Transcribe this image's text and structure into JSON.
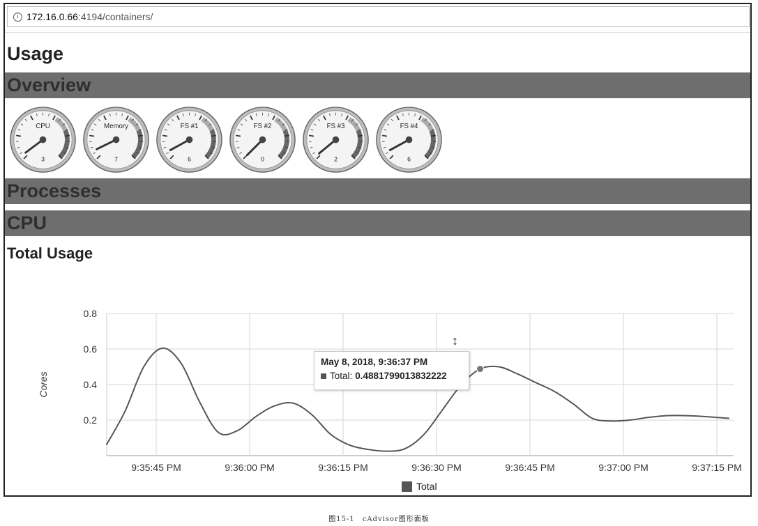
{
  "browser": {
    "url_host": "172.16.0.66",
    "url_port_path": ":4194/containers/"
  },
  "page": {
    "title": "Usage",
    "sections": {
      "overview": "Overview",
      "processes": "Processes",
      "cpu": "CPU"
    },
    "total_usage_title": "Total Usage"
  },
  "gauges": [
    {
      "label": "CPU",
      "value": "3",
      "level": 0.03
    },
    {
      "label": "Memory",
      "value": "7",
      "level": 0.07
    },
    {
      "label": "FS #1",
      "value": "6",
      "level": 0.06
    },
    {
      "label": "FS #2",
      "value": "0",
      "level": 0.0
    },
    {
      "label": "FS #3",
      "value": "2",
      "level": 0.02
    },
    {
      "label": "FS #4",
      "value": "6",
      "level": 0.06
    }
  ],
  "chart_data": {
    "type": "line",
    "title": "",
    "ylabel": "Cores",
    "xlabel": "",
    "ylim": [
      0,
      0.8
    ],
    "y_ticks": [
      "0.2",
      "0.4",
      "0.6",
      "0.8"
    ],
    "x_ticks": [
      "9:35:45 PM",
      "9:36:00 PM",
      "9:36:15 PM",
      "9:36:30 PM",
      "9:36:45 PM",
      "9:37:00 PM",
      "9:37:15 PM"
    ],
    "grid": true,
    "legend_position": "bottom",
    "series": [
      {
        "name": "Total",
        "color": "#555555",
        "points": [
          [
            "9:35:37 PM",
            0.06
          ],
          [
            "9:35:40 PM",
            0.25
          ],
          [
            "9:35:43 PM",
            0.5
          ],
          [
            "9:35:46 PM",
            0.605
          ],
          [
            "9:35:49 PM",
            0.52
          ],
          [
            "9:35:52 PM",
            0.3
          ],
          [
            "9:35:55 PM",
            0.13
          ],
          [
            "9:35:58 PM",
            0.14
          ],
          [
            "9:36:01 PM",
            0.22
          ],
          [
            "9:36:04 PM",
            0.28
          ],
          [
            "9:36:07 PM",
            0.295
          ],
          [
            "9:36:10 PM",
            0.23
          ],
          [
            "9:36:13 PM",
            0.12
          ],
          [
            "9:36:16 PM",
            0.06
          ],
          [
            "9:36:19 PM",
            0.035
          ],
          [
            "9:36:22 PM",
            0.025
          ],
          [
            "9:36:25 PM",
            0.04
          ],
          [
            "9:36:28 PM",
            0.12
          ],
          [
            "9:36:31 PM",
            0.26
          ],
          [
            "9:36:34 PM",
            0.4
          ],
          [
            "9:36:37 PM",
            0.4881799013832222
          ],
          [
            "9:36:40 PM",
            0.5
          ],
          [
            "9:36:43 PM",
            0.46
          ],
          [
            "9:36:46 PM",
            0.41
          ],
          [
            "9:36:49 PM",
            0.36
          ],
          [
            "9:36:52 PM",
            0.29
          ],
          [
            "9:36:55 PM",
            0.21
          ],
          [
            "9:36:58 PM",
            0.195
          ],
          [
            "9:37:01 PM",
            0.2
          ],
          [
            "9:37:04 PM",
            0.215
          ],
          [
            "9:37:07 PM",
            0.225
          ],
          [
            "9:37:10 PM",
            0.225
          ],
          [
            "9:37:13 PM",
            0.22
          ],
          [
            "9:37:17 PM",
            0.21
          ]
        ]
      }
    ]
  },
  "tooltip": {
    "title": "May 8, 2018, 9:36:37 PM",
    "series_label": "Total:",
    "value": "0.4881799013832222"
  },
  "legend": {
    "label": "Total"
  },
  "caption": "图15-1　cAdvisor图形面板"
}
